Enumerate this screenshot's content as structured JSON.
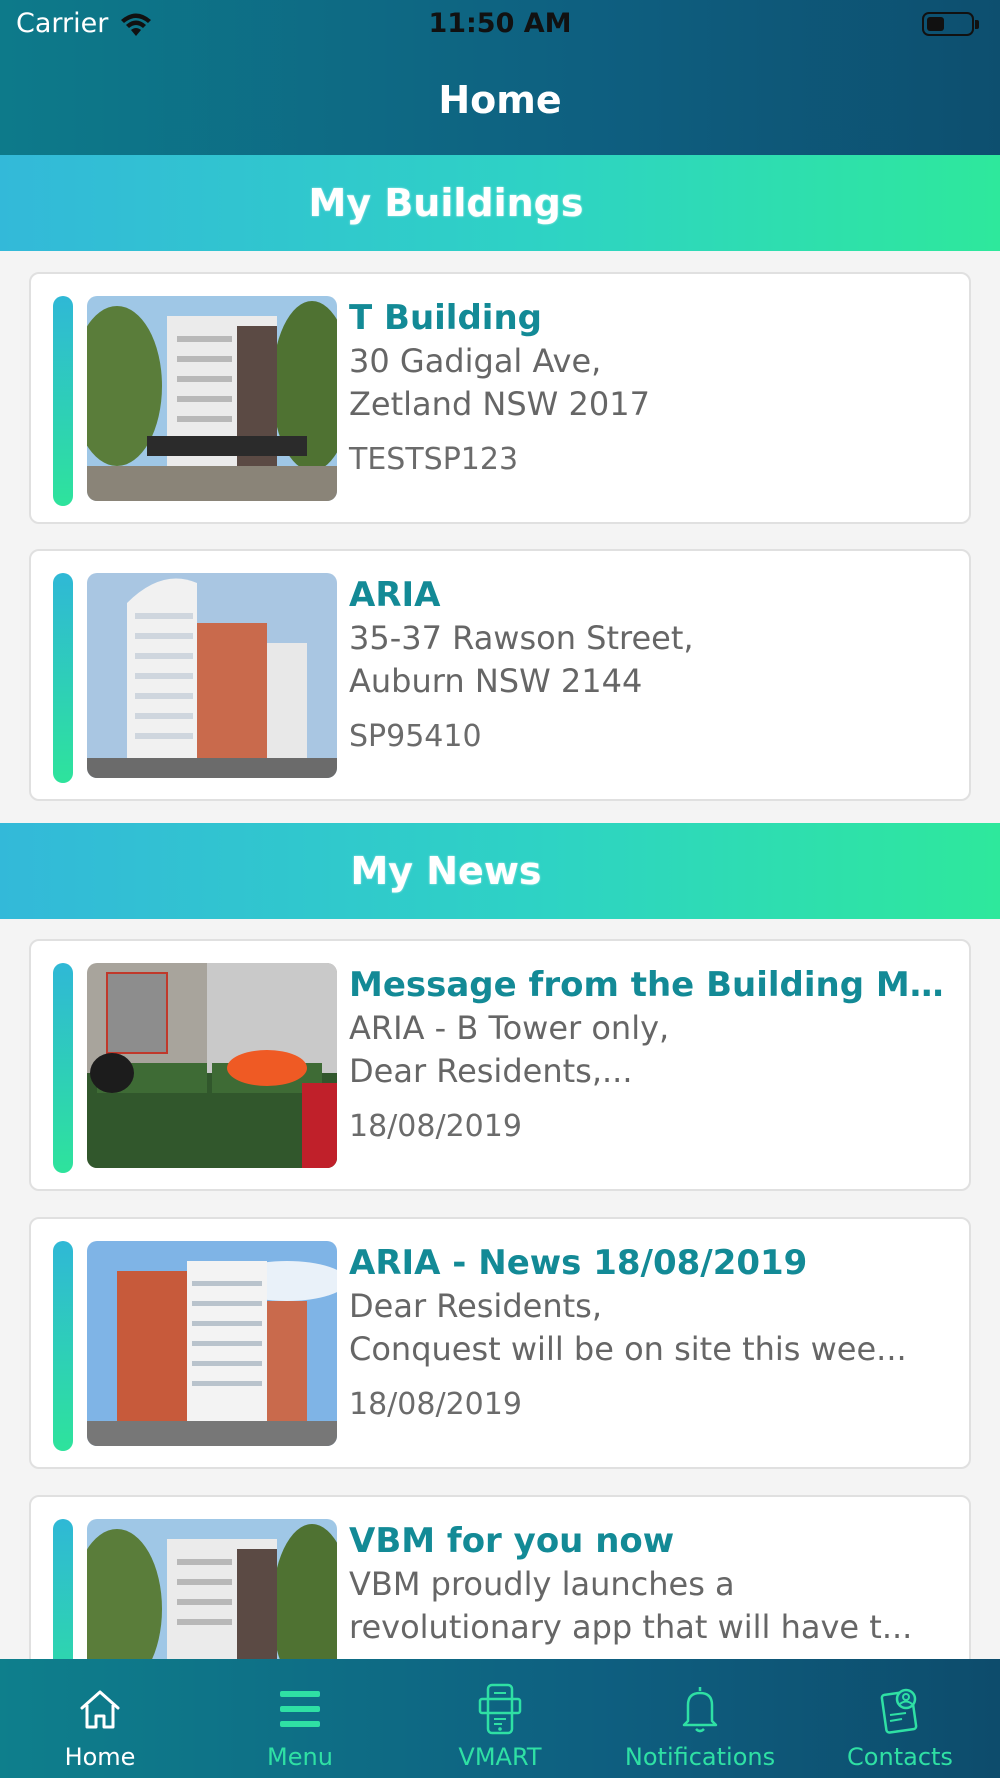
{
  "status_bar": {
    "carrier": "Carrier",
    "time": "11:50 AM"
  },
  "header": {
    "title": "Home"
  },
  "sections": {
    "buildings": {
      "title": "My Buildings"
    },
    "news": {
      "title": "My News"
    }
  },
  "buildings": [
    {
      "name": "T Building",
      "address_line1": "30 Gadigal Ave,",
      "address_line2": "Zetland NSW 2017",
      "code": "TESTSP123"
    },
    {
      "name": "ARIA",
      "address_line1": "35-37 Rawson Street,",
      "address_line2": "Auburn NSW 2144",
      "code": "SP95410"
    }
  ],
  "news": [
    {
      "title": "Message from the Building Man...",
      "line1": "ARIA - B Tower only,",
      "line2": "Dear Residents,...",
      "date": "18/08/2019"
    },
    {
      "title": "ARIA - News 18/08/2019",
      "line1": "Dear Residents,",
      "line2": "Conquest will be on site this wee...",
      "date": "18/08/2019"
    },
    {
      "title": "VBM for you now",
      "line1": "VBM proudly launches a",
      "line2": "revolutionary app that will have t..."
    }
  ],
  "tabs": [
    {
      "label": "Home",
      "icon": "home-icon",
      "active": true
    },
    {
      "label": "Menu",
      "icon": "menu-icon"
    },
    {
      "label": "VMART",
      "icon": "vmart-icon"
    },
    {
      "label": "Notifications",
      "icon": "bell-icon"
    },
    {
      "label": "Contacts",
      "icon": "contacts-icon"
    }
  ],
  "colors": {
    "header": "#0e5f80",
    "accent_teal": "#138a96",
    "banner_start": "#33b9d9",
    "banner_end": "#2ee89c",
    "tab_inactive": "#2fe0a4"
  }
}
